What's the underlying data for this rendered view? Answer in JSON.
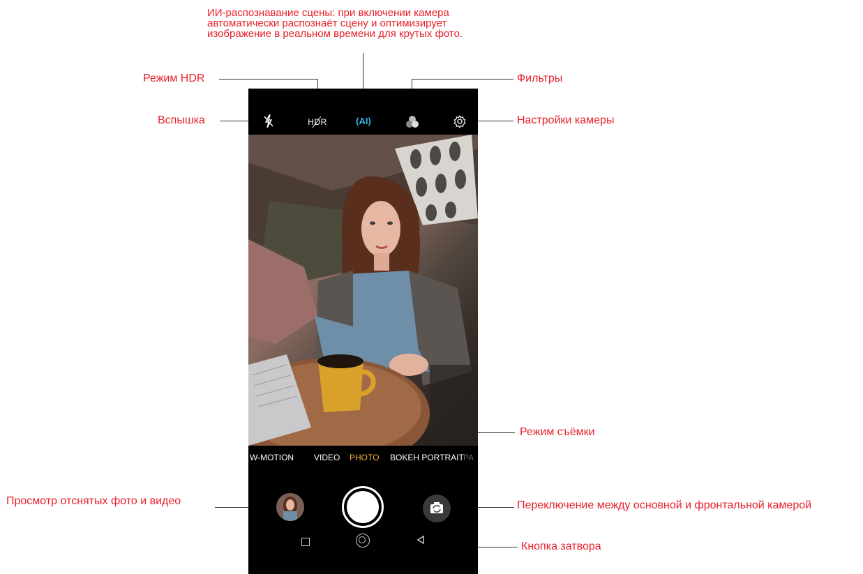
{
  "annotations": {
    "ai_scene": "ИИ-распознавание сцены: при включении камера\nавтоматически распознаёт сцену и оптимизирует\nизображение в реальном времени для крутых фото.",
    "hdr": "Режим HDR",
    "filters": "Фильтры",
    "flash": "Вспышка",
    "settings": "Настройки камеры",
    "shooting_mode": "Режим съёмки",
    "gallery": "Просмотр отснятых фото и видео",
    "switch_camera": "Переключение между основной и фронтальной камерой",
    "shutter": "Кнопка затвора"
  },
  "topbar": {
    "hdr_label": "HDR",
    "ai_label": "(AI)"
  },
  "modes": [
    "W-MOTION",
    "VIDEO",
    "PHOTO",
    "BOKEH PORTRAIT",
    "PA"
  ],
  "active_mode": "PHOTO",
  "colors": {
    "annotation": "#e8202a",
    "active_mode": "#f2b23a",
    "ai_icon": "#32b5e8"
  },
  "icons": [
    "flash-off-icon",
    "hdr-off-icon",
    "ai-scene-icon",
    "filters-icon",
    "gear-icon",
    "gallery-thumbnail",
    "shutter-button",
    "switch-camera-icon",
    "square-icon",
    "circle-home-icon",
    "triangle-back-icon"
  ]
}
